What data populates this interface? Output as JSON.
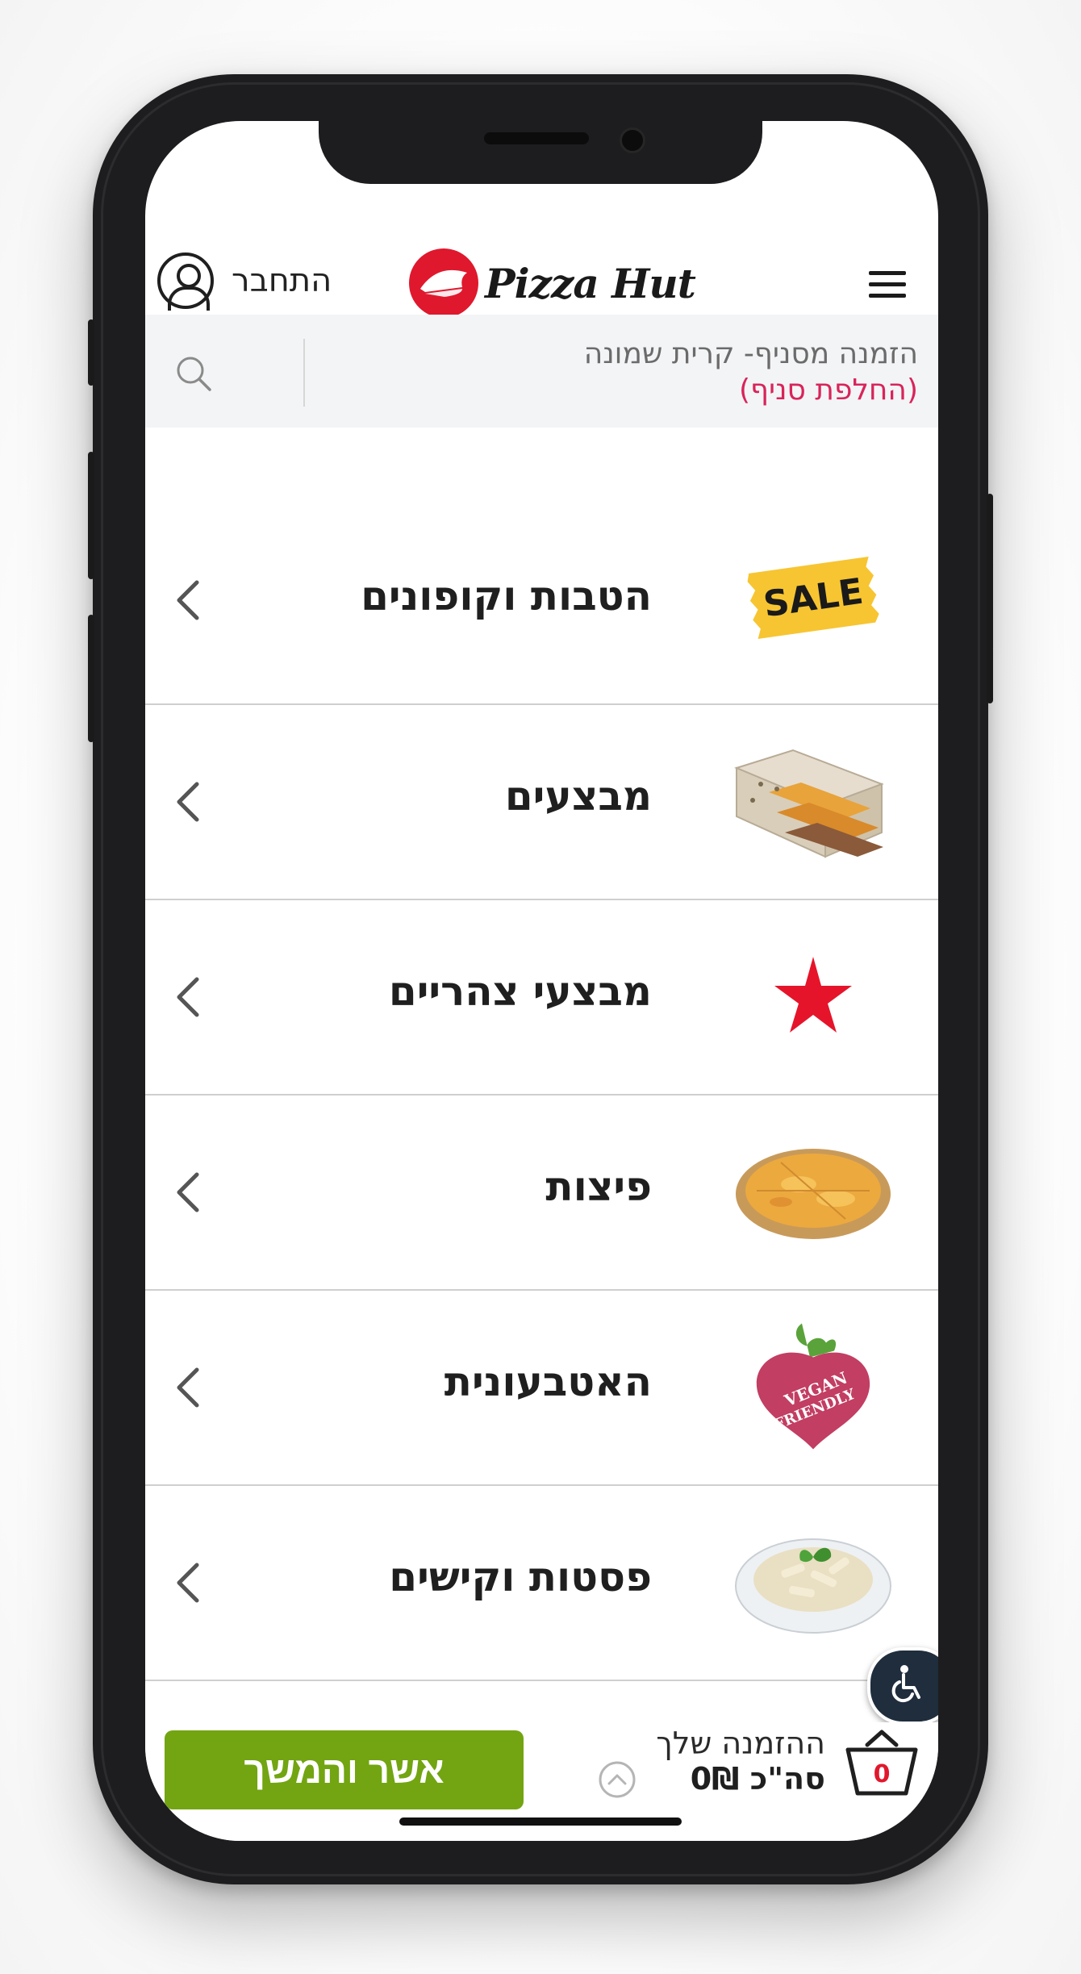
{
  "header": {
    "login_label": "התחבר",
    "brand_name": "Pizza Hut"
  },
  "branch": {
    "current": "הזמנה מסניף- קרית שמונה",
    "change_link": "(החלפת סניף)"
  },
  "menu": {
    "items": [
      {
        "label": "הטבות וקופונים",
        "thumb": "sale-tag"
      },
      {
        "label": "מבצעים",
        "thumb": "pizza-boxes"
      },
      {
        "label": "מבצעי צהריים",
        "thumb": "red-star"
      },
      {
        "label": "פיצות",
        "thumb": "pizza"
      },
      {
        "label": "האטבעונית",
        "thumb": "vegan-friendly-beet"
      },
      {
        "label": "פסטות וקישים",
        "thumb": "pasta-bowl"
      },
      {
        "label": "",
        "thumb": "nuggets"
      }
    ],
    "sale_text": "SALE",
    "vegan_text_1": "VEGAN",
    "vegan_text_2": "FRIENDLY"
  },
  "cart": {
    "title": "ההזמנה שלך",
    "total": "סה\"כ 0₪",
    "count": "0",
    "confirm_label": "אשר והמשך"
  },
  "colors": {
    "brand_red": "#e0182d",
    "link_pink": "#d8245a",
    "confirm_green": "#72a511"
  }
}
